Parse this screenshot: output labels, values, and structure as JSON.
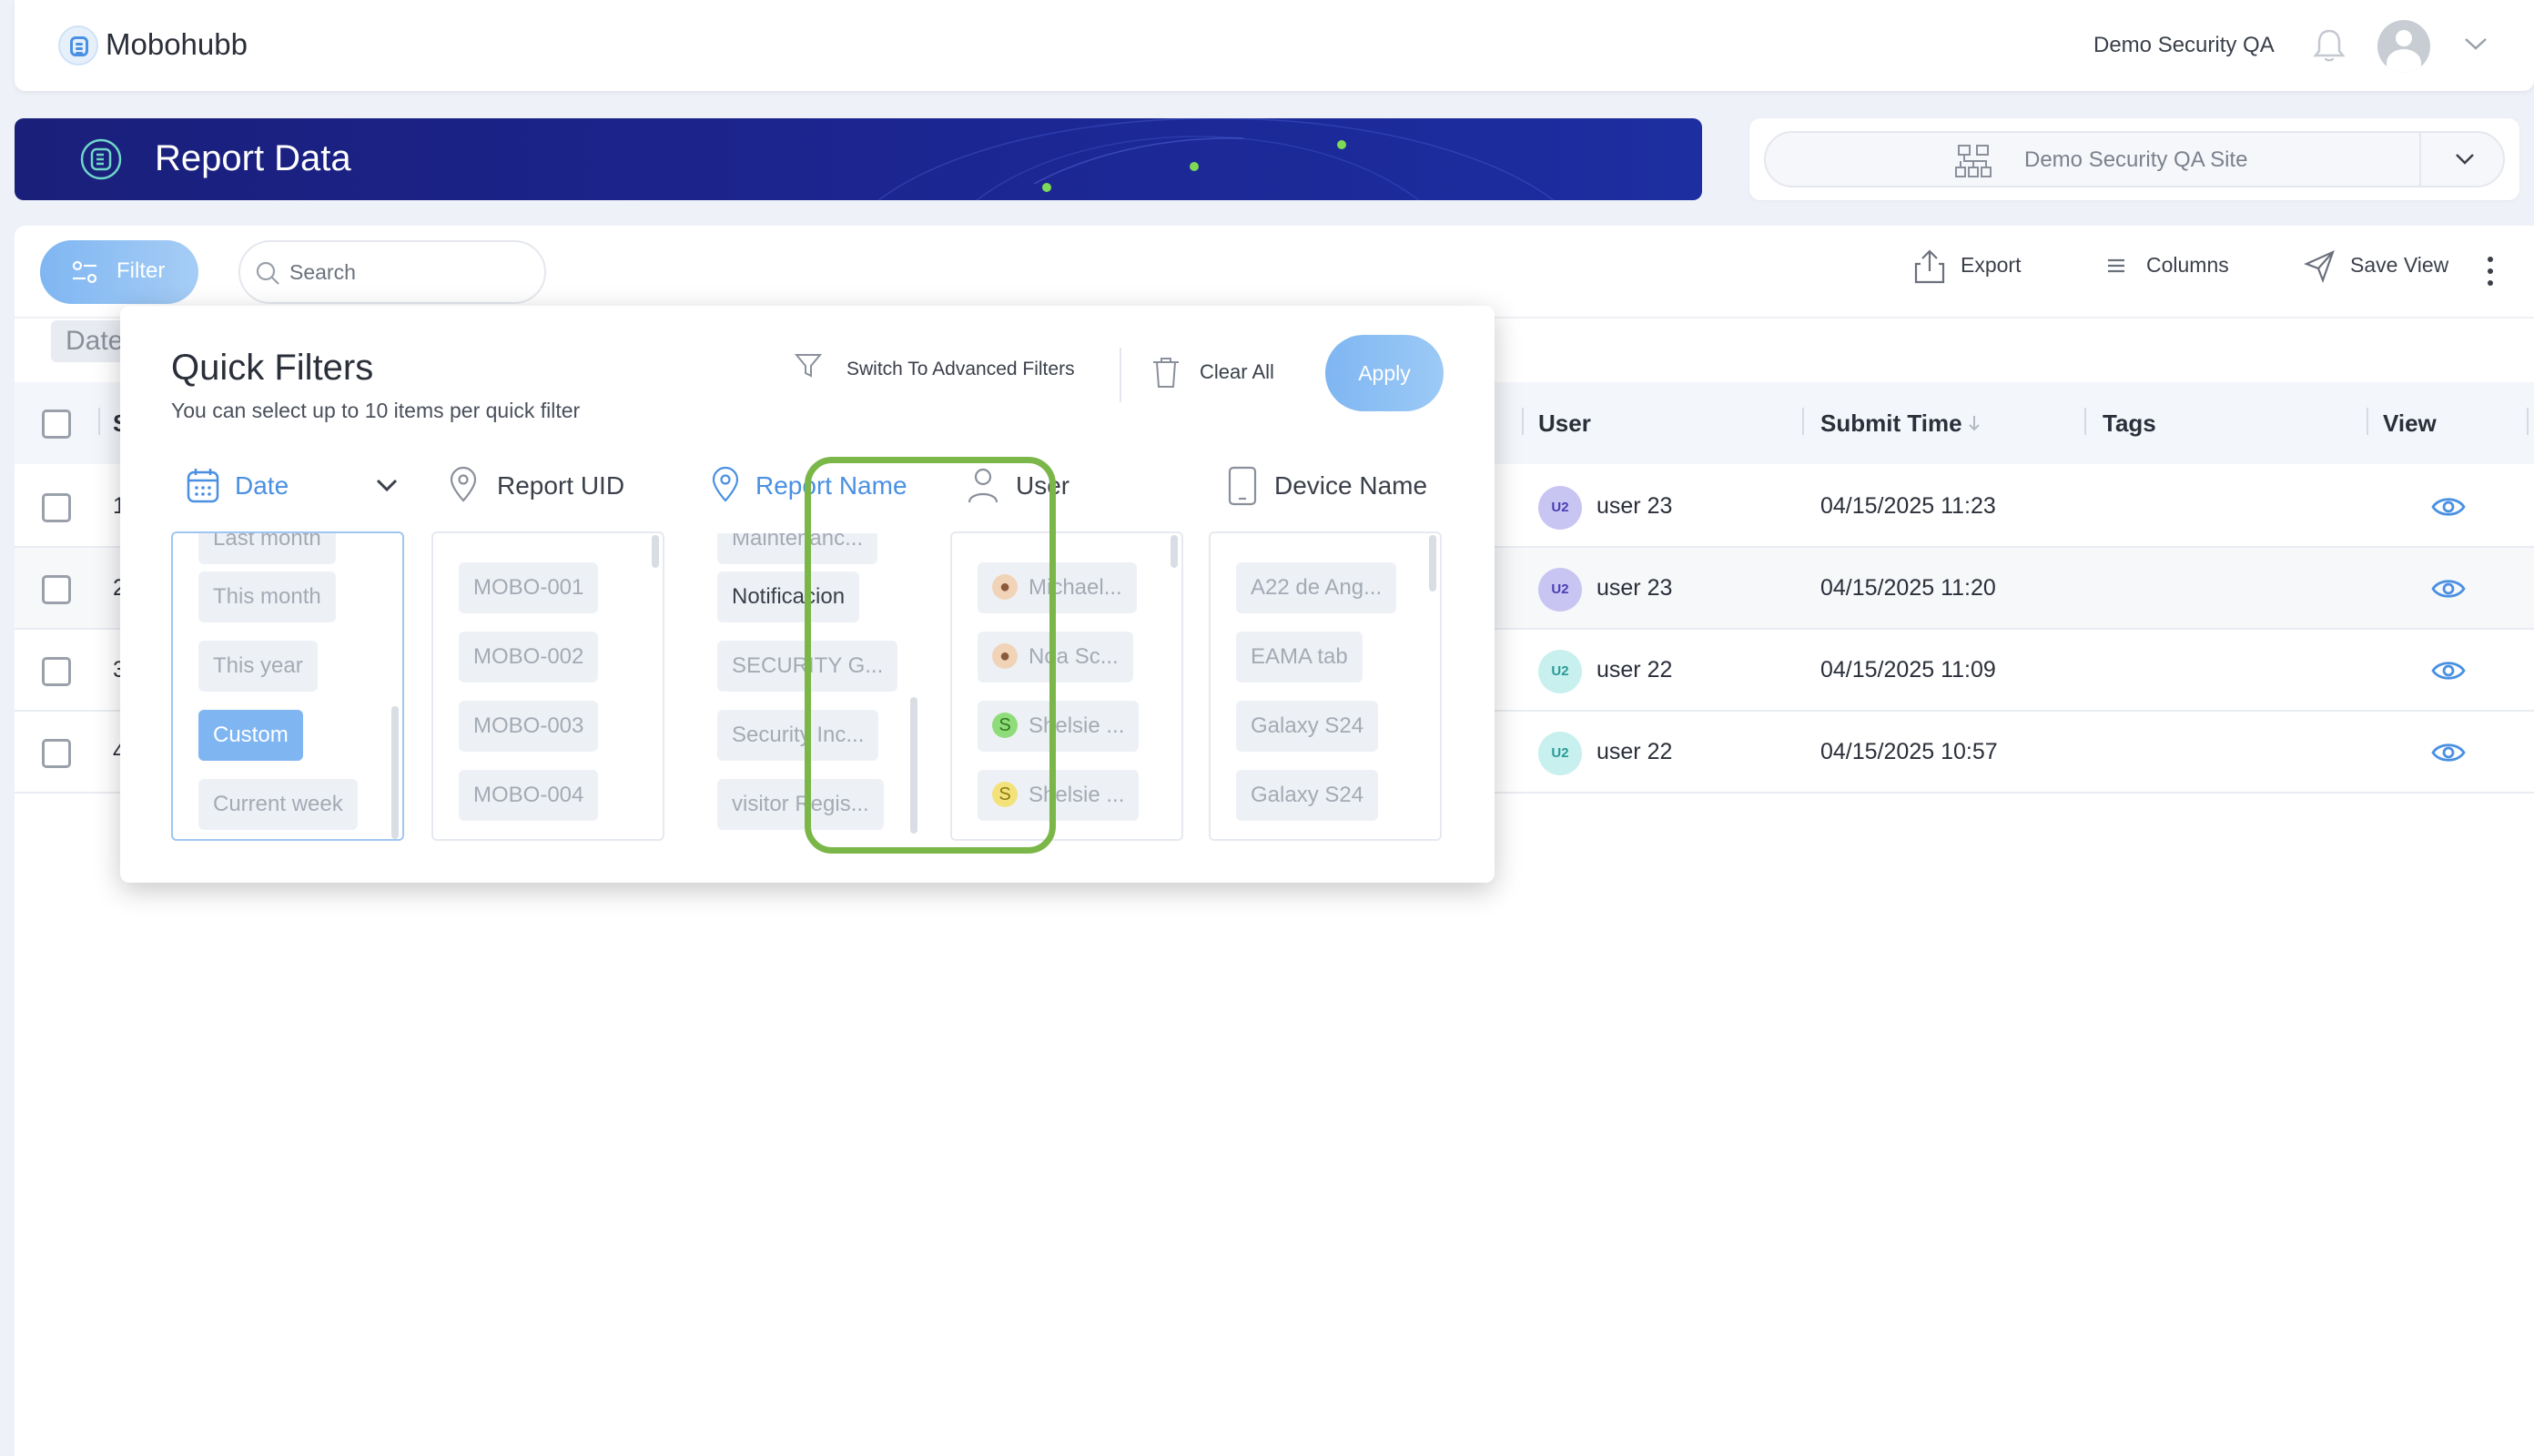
{
  "app": {
    "name": "Mobohubb",
    "account": "Demo Security QA"
  },
  "banner": {
    "title": "Report Data"
  },
  "site_selector": {
    "value": "Demo Security QA Site"
  },
  "toolbar": {
    "filter_label": "Filter",
    "search_placeholder": "Search",
    "export_label": "Export",
    "columns_label": "Columns",
    "save_view_label": "Save View"
  },
  "date_chip": "Date",
  "table": {
    "headers": {
      "select": "S",
      "user": "User",
      "submit_time": "Submit Time",
      "tags": "Tags",
      "view": "View"
    },
    "rows": [
      {
        "lead": "1",
        "badge": "U2",
        "user": "user 23",
        "submit_time": "04/15/2025 11:23",
        "badge_bg": "#c9c5f3",
        "badge_fg": "#4a3fb0"
      },
      {
        "lead": "2",
        "badge": "U2",
        "user": "user 23",
        "submit_time": "04/15/2025 11:20",
        "badge_bg": "#c9c5f3",
        "badge_fg": "#4a3fb0"
      },
      {
        "lead": "3",
        "badge": "U2",
        "user": "user 22",
        "submit_time": "04/15/2025 11:09",
        "badge_bg": "#c8f0ef",
        "badge_fg": "#2a9b97"
      },
      {
        "lead": "4",
        "badge": "U2",
        "user": "user 22",
        "submit_time": "04/15/2025 10:57",
        "badge_bg": "#c8f0ef",
        "badge_fg": "#2a9b97"
      }
    ]
  },
  "quick_filters": {
    "title": "Quick Filters",
    "subtitle": "You can select up to 10 items per quick filter",
    "advanced_label": "Switch To Advanced Filters",
    "clear_label": "Clear All",
    "apply_label": "Apply",
    "columns": {
      "date": {
        "label": "Date",
        "items": [
          "Last month",
          "This month",
          "This year",
          "Custom",
          "Current week"
        ],
        "selected": "Custom"
      },
      "report_uid": {
        "label": "Report UID",
        "items": [
          "MOBO-001",
          "MOBO-002",
          "MOBO-003",
          "MOBO-004"
        ]
      },
      "report_name": {
        "label": "Report Name",
        "items": [
          "Maintenanc...",
          "Notificacion",
          "SECURITY G...",
          "Security Inc...",
          "visitor Regis..."
        ]
      },
      "user": {
        "label": "User",
        "items": [
          {
            "name": "Michael...",
            "avatar": "photo"
          },
          {
            "name": "Noa Sc...",
            "avatar": "photo"
          },
          {
            "name": "Shelsie ...",
            "avatar": "S"
          },
          {
            "name": "Shelsie ...",
            "avatar": "S"
          }
        ]
      },
      "device_name": {
        "label": "Device Name",
        "items": [
          "A22 de Ang...",
          "EAMA tab",
          "Galaxy S24",
          "Galaxy S24"
        ]
      }
    }
  },
  "colors": {
    "accent": "#4a90e2",
    "highlight": "#7ab648",
    "banner": "#1c2590"
  }
}
